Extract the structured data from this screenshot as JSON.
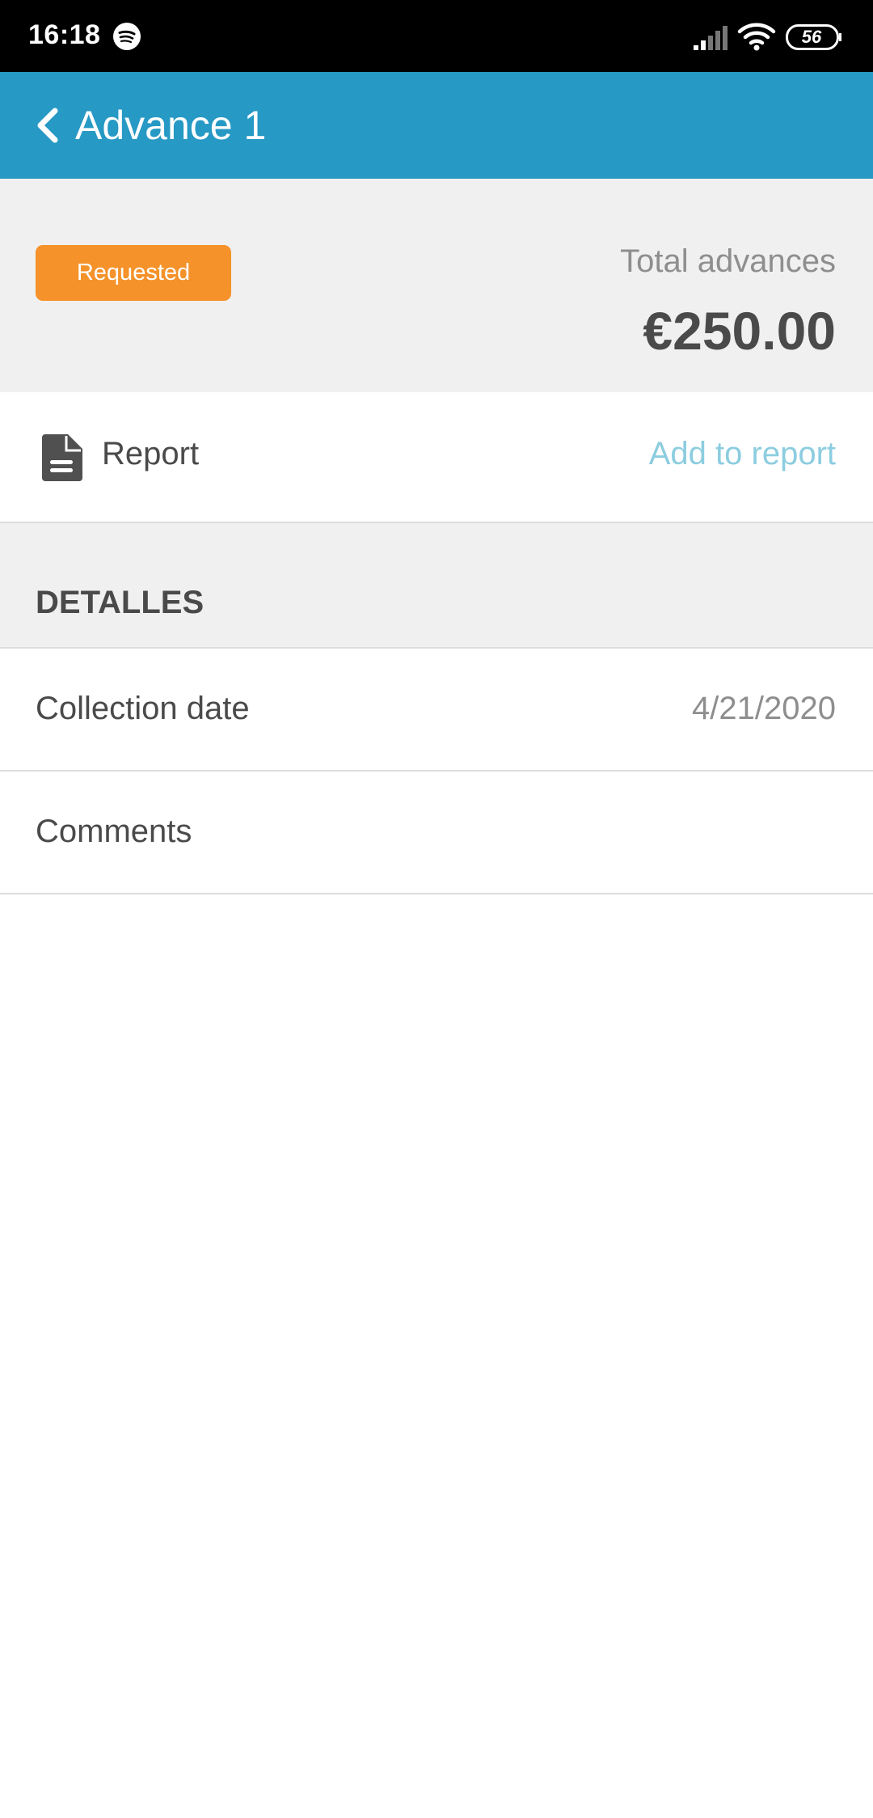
{
  "status_bar": {
    "time": "16:18",
    "battery": "56",
    "icons": [
      "spotify-icon",
      "signal-icon",
      "wifi-icon",
      "battery-icon"
    ]
  },
  "app_bar": {
    "title": "Advance 1",
    "back_icon": "chevron-left-icon",
    "background": "#2699c4"
  },
  "summary": {
    "status": "Requested",
    "status_color": "#f5922a",
    "total_label": "Total advances",
    "total_amount": "€250.00"
  },
  "report": {
    "icon": "document-icon",
    "label": "Report",
    "action": "Add to report"
  },
  "details": {
    "section_title": "DETALLES",
    "rows": [
      {
        "label": "Collection date",
        "value": "4/21/2020"
      },
      {
        "label": "Comments",
        "value": ""
      }
    ]
  }
}
